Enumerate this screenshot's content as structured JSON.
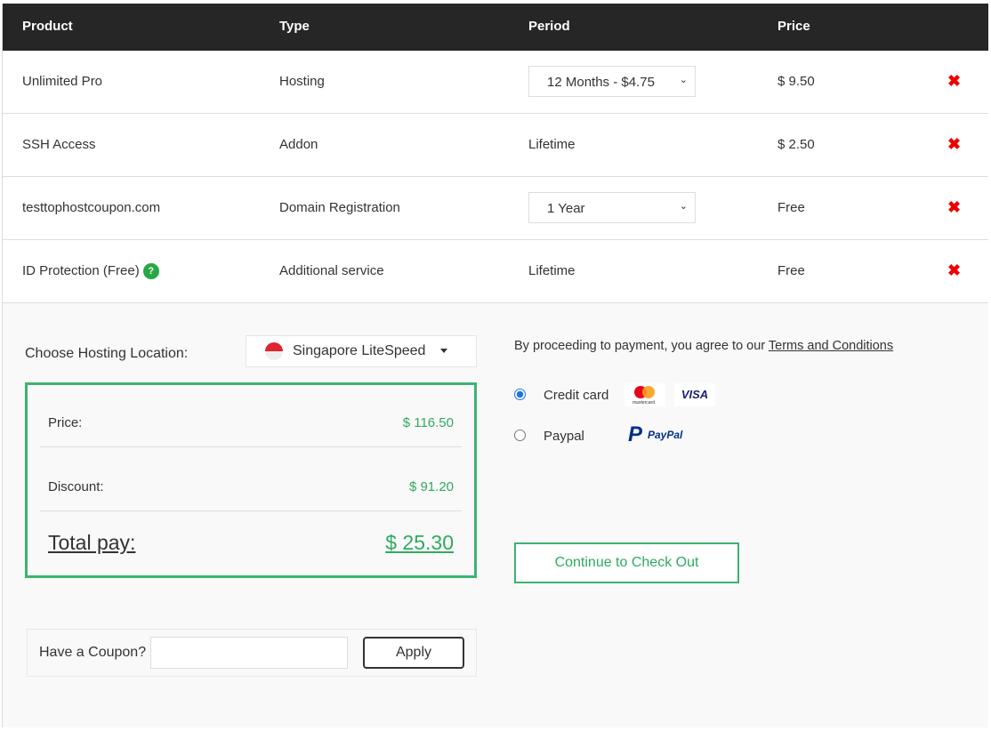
{
  "table": {
    "headers": [
      "Product",
      "Type",
      "Period",
      "Price"
    ],
    "rows": [
      {
        "product": "Unlimited Pro",
        "type": "Hosting",
        "period": "12 Months - $4.75",
        "period_is_select": true,
        "price": "$ 9.50"
      },
      {
        "product": "SSH Access",
        "type": "Addon",
        "period": "Lifetime",
        "price": "$ 2.50"
      },
      {
        "product": "testtophostcoupon.com",
        "type": "Domain Registration",
        "period": "1 Year",
        "period_is_select": true,
        "price": "Free"
      },
      {
        "product": "ID Protection (Free)",
        "type": "Additional service",
        "period": "Lifetime",
        "price": "Free",
        "help_icon": "?"
      }
    ],
    "delete_icon": "✖"
  },
  "location": {
    "label": "Choose Hosting Location:",
    "value": "Singapore LiteSpeed",
    "flag": "singapore-flag"
  },
  "summary": {
    "price_label": "Price:",
    "price": "$ 116.50",
    "discount_label": "Discount:",
    "discount": "$ 91.20",
    "total_label": "Total pay:",
    "total": "$ 25.30"
  },
  "coupon": {
    "label": "Have a Coupon?",
    "value": "",
    "apply": "Apply"
  },
  "payment": {
    "terms_prefix": "By proceeding to payment, you agree to our ",
    "terms_link": "Terms and Conditions",
    "credit_card": "Credit card",
    "paypal": "Paypal",
    "selected": "credit_card",
    "mastercard": "mastercard",
    "visa": "VISA",
    "paypal_logo": "PayPal"
  },
  "checkout": "Continue to Check Out",
  "colors": {
    "accent": "#3cb371",
    "header": "#262626",
    "delete": "#e00000"
  }
}
